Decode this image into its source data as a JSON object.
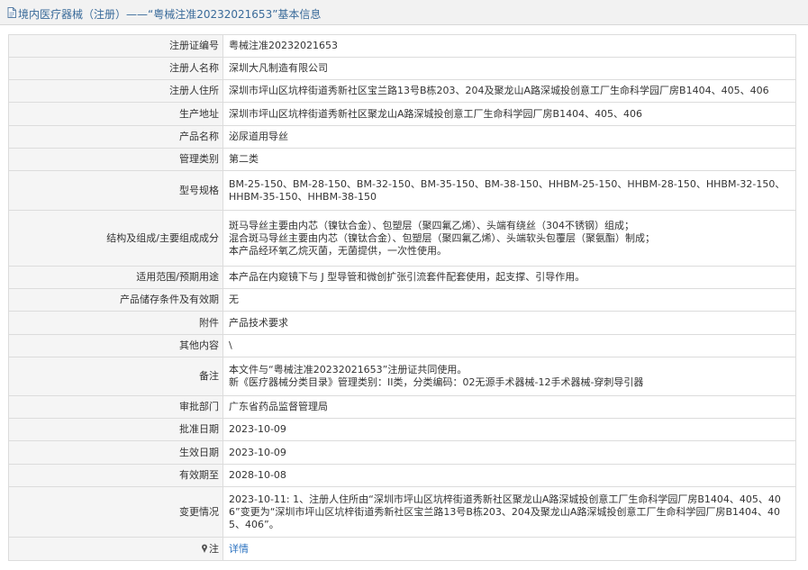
{
  "header": {
    "title": "境内医疗器械（注册）——“粤械注准20232021653”基本信息"
  },
  "rows": [
    {
      "label": "注册证编号",
      "lines": [
        "粤械注准20232021653"
      ]
    },
    {
      "label": "注册人名称",
      "lines": [
        "深圳大凡制造有限公司"
      ]
    },
    {
      "label": "注册人住所",
      "lines": [
        "深圳市坪山区坑梓街道秀新社区宝兰路13号B栋203、204及聚龙山A路深城投创意工厂生命科学园厂房B1404、405、406"
      ]
    },
    {
      "label": "生产地址",
      "lines": [
        "深圳市坪山区坑梓街道秀新社区聚龙山A路深城投创意工厂生命科学园厂房B1404、405、406"
      ]
    },
    {
      "label": "产品名称",
      "lines": [
        "泌尿道用导丝"
      ]
    },
    {
      "label": "管理类别",
      "lines": [
        "第二类"
      ]
    },
    {
      "label": "型号规格",
      "lines": [
        "BM-25-150、BM-28-150、BM-32-150、BM-35-150、BM-38-150、HHBM-25-150、HHBM-28-150、HHBM-32-150、HHBM-35-150、HHBM-38-150"
      ]
    },
    {
      "label": "结构及组成/主要组成成分",
      "lines": [
        "斑马导丝主要由内芯（镍钛合金）、包塑层（聚四氟乙烯）、头端有绕丝（304不锈钢）组成；",
        "混合斑马导丝主要由内芯（镍钛合金）、包塑层（聚四氟乙烯）、头端软头包覆层（聚氨酯）制成；",
        "本产品经环氧乙烷灭菌，无菌提供，一次性使用。"
      ]
    },
    {
      "label": "适用范围/预期用途",
      "lines": [
        "本产品在内窥镜下与 J 型导管和微创扩张引流套件配套使用，起支撑、引导作用。"
      ]
    },
    {
      "label": "产品储存条件及有效期",
      "lines": [
        "无"
      ]
    },
    {
      "label": "附件",
      "lines": [
        "产品技术要求"
      ]
    },
    {
      "label": "其他内容",
      "lines": [
        "\\"
      ]
    },
    {
      "label": "备注",
      "lines": [
        "本文件与“粤械注准20232021653”注册证共同使用。",
        "新《医疗器械分类目录》管理类别：II类，分类编码：02无源手术器械-12手术器械-穿刺导引器"
      ]
    },
    {
      "label": "审批部门",
      "lines": [
        "广东省药品监督管理局"
      ]
    },
    {
      "label": "批准日期",
      "lines": [
        "2023-10-09"
      ]
    },
    {
      "label": "生效日期",
      "lines": [
        "2023-10-09"
      ]
    },
    {
      "label": "有效期至",
      "lines": [
        "2028-10-08"
      ]
    },
    {
      "label": "变更情况",
      "lines": [
        "2023-10-11: 1、注册人住所由“深圳市坪山区坑梓街道秀新社区聚龙山A路深城投创意工厂生命科学园厂房B1404、405、406”变更为“深圳市坪山区坑梓街道秀新社区宝兰路13号B栋203、204及聚龙山A路深城投创意工厂生命科学园厂房B1404、405、406”。"
      ]
    }
  ],
  "note": {
    "label": "注",
    "link": "详情"
  },
  "colors": {
    "header_text": "#3a6b9a",
    "link": "#2b72c0",
    "label_bg": "#f5f5f5",
    "border": "#dcdcdc"
  },
  "icons": {
    "header": "document-icon",
    "note": "pin-icon"
  }
}
